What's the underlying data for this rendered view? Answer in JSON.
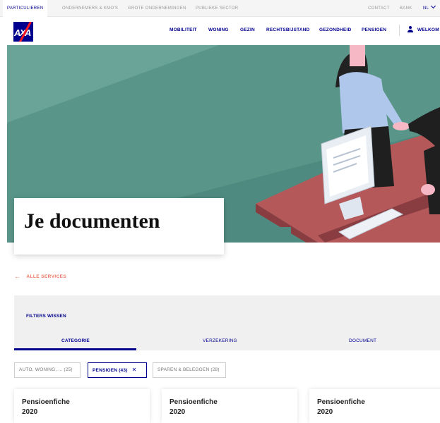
{
  "segments": [
    {
      "label": "PARTICULIEREN",
      "active": true
    },
    {
      "label": "ONDERNEMERS & KMO'S",
      "active": false
    },
    {
      "label": "GROTE ONDERNEMINGEN",
      "active": false
    },
    {
      "label": "PUBLIEKE SECTOR",
      "active": false
    }
  ],
  "utility": {
    "contact": "CONTACT",
    "bank": "BANK",
    "language": "NL"
  },
  "logo": {
    "text": "AXA"
  },
  "nav": {
    "items": [
      "MOBILITEIT",
      "WONING",
      "GEZIN",
      "RECHTSBIJSTAND",
      "GEZONDHEID",
      "PENSIOEN"
    ],
    "welcome": "WELKOM"
  },
  "hero": {
    "title": "Je documenten"
  },
  "back_link": {
    "label": "ALLE SERVICES"
  },
  "filters": {
    "clear_label": "FILTERS WISSEN",
    "tabs": [
      "CATEGORIE",
      "VERZEKERING",
      "DOCUMENT"
    ],
    "active_tab": "CATEGORIE"
  },
  "chips": [
    {
      "label": "AUTO, WONING, ... (25)",
      "active": false
    },
    {
      "label": "PENSIOEN (43)",
      "active": true
    },
    {
      "label": "SPAREN & BELEGGEN (28)",
      "active": false
    }
  ],
  "cards": [
    {
      "title": "Pensioenfiche",
      "year": "2020"
    },
    {
      "title": "Pensioenfiche",
      "year": "2020"
    },
    {
      "title": "Pensioenfiche",
      "year": "2020"
    }
  ],
  "colors": {
    "brand": "#00008f",
    "accent": "#f07662",
    "hero_bg": "#4f8a80",
    "desk": "#b4585a"
  }
}
